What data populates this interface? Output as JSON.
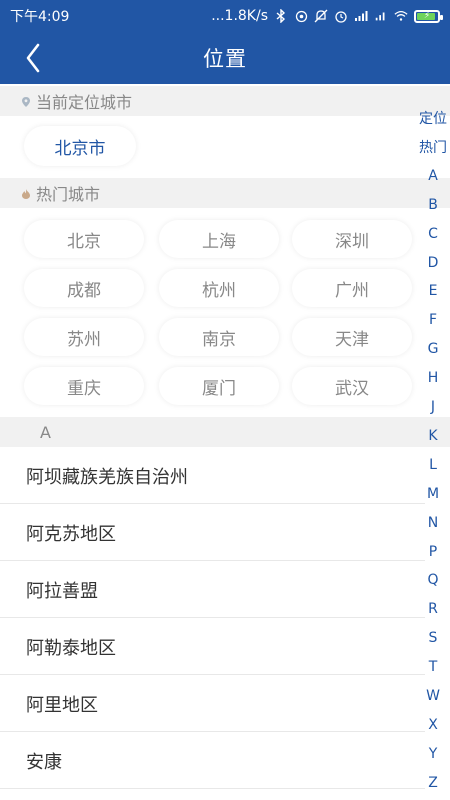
{
  "status_bar": {
    "time": "下午4:09",
    "network_speed": "...1.8K/s",
    "icons": [
      "signal-dots-icon",
      "bluetooth-icon",
      "location-icon",
      "mute-icon",
      "alarm-icon",
      "cell-signal-icon",
      "hd-signal-icon",
      "wifi-icon",
      "battery-icon"
    ],
    "battery_color": "#6fd35a",
    "battery_level": 0.9
  },
  "header": {
    "title": "位置",
    "back_icon": "chevron-left-icon",
    "background": "#2156a5"
  },
  "current_location": {
    "header": "当前定位城市",
    "city": "北京市"
  },
  "hot_cities": {
    "header": "热门城市",
    "items": [
      "北京",
      "上海",
      "深圳",
      "成都",
      "杭州",
      "广州",
      "苏州",
      "南京",
      "天津",
      "重庆",
      "厦门",
      "武汉"
    ]
  },
  "city_list": {
    "letter": "A",
    "items": [
      "阿坝藏族羌族自治州",
      "阿克苏地区",
      "阿拉善盟",
      "阿勒泰地区",
      "阿里地区",
      "安康"
    ]
  },
  "index_bar": {
    "items": [
      "定位",
      "热门",
      "A",
      "B",
      "C",
      "D",
      "E",
      "F",
      "G",
      "H",
      "J",
      "K",
      "L",
      "M",
      "N",
      "P",
      "Q",
      "R",
      "S",
      "T",
      "W",
      "X",
      "Y",
      "Z"
    ],
    "color": "#2156a5"
  }
}
